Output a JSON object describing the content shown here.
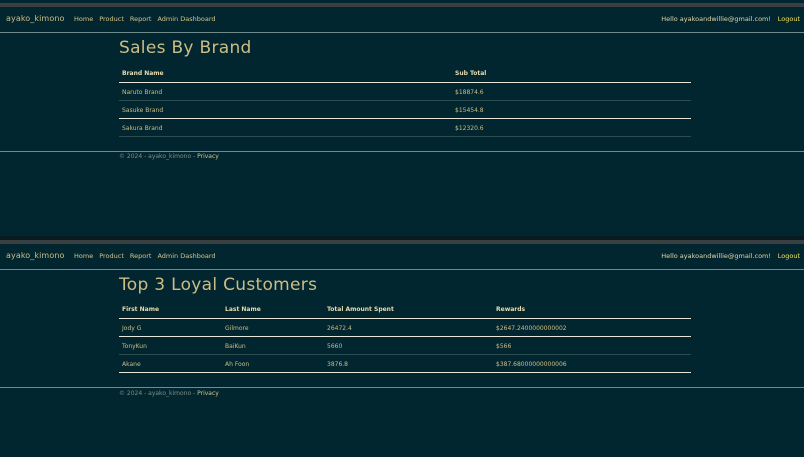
{
  "app": {
    "brand": "ayako_kimono",
    "nav": [
      "Home",
      "Product",
      "Report",
      "Admin Dashboard"
    ],
    "greeting": "Hello ayakoandwillie@gmail.com!",
    "logout": "Logout"
  },
  "sales_by_brand": {
    "title": "Sales By Brand",
    "columns": [
      "Brand Name",
      "Sub Total"
    ],
    "rows": [
      [
        "Naruto Brand",
        "$18874.6"
      ],
      [
        "Sasuke Brand",
        "$15454.8"
      ],
      [
        "Sakura Brand",
        "$12320.6"
      ]
    ]
  },
  "loyal_customers": {
    "title": "Top 3 Loyal Customers",
    "columns": [
      "First Name",
      "Last Name",
      "Total Amount Spent",
      "Rewards"
    ],
    "rows": [
      [
        "Jody G",
        "Gilmore",
        "26472.4",
        "$2647.2400000000002"
      ],
      [
        "TonyKun",
        "BaiKun",
        "5660",
        "$566"
      ],
      [
        "Akane",
        "Ah Foon",
        "3876.8",
        "$387.68000000000006"
      ]
    ]
  },
  "footer": {
    "text": "© 2024 - ayako_kimono - ",
    "privacy": "Privacy"
  }
}
